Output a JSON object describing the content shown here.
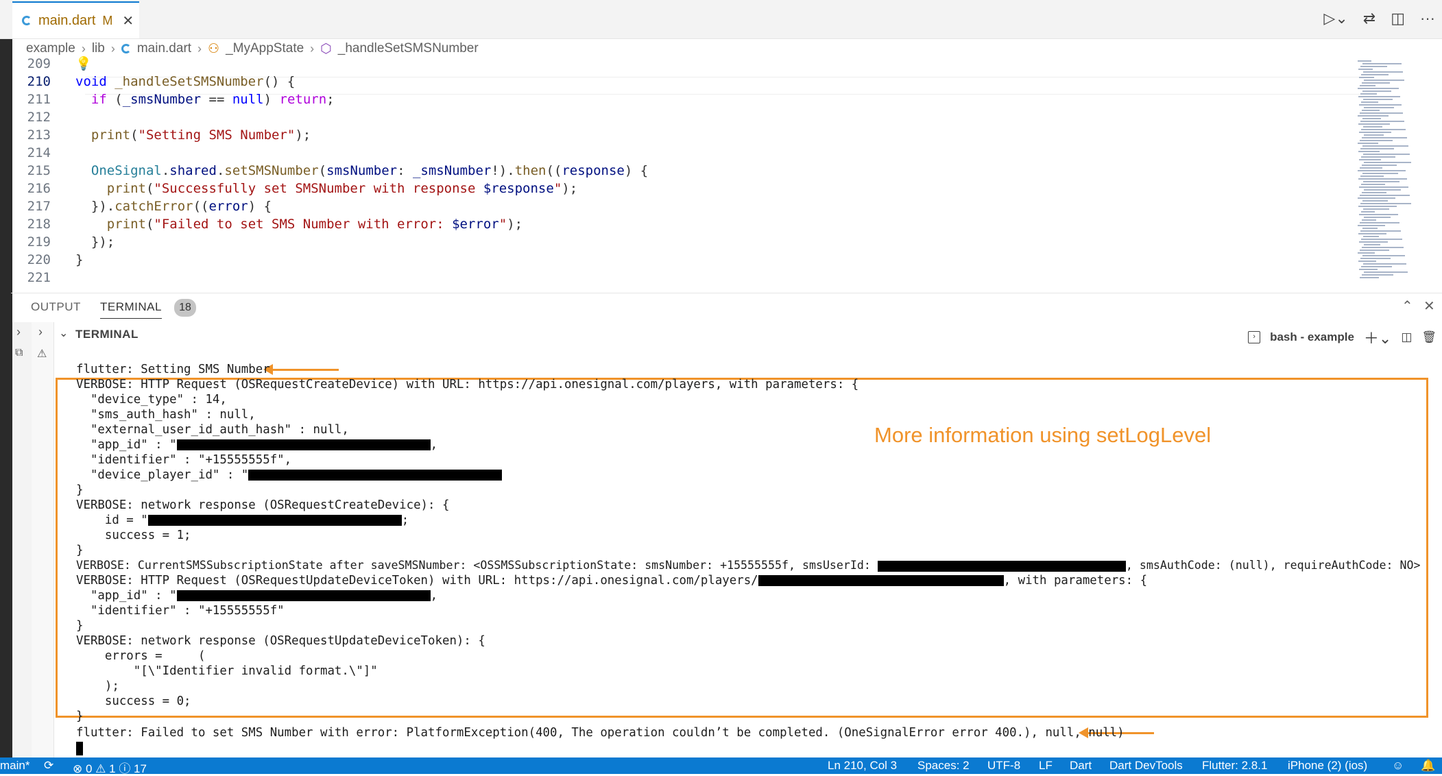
{
  "tab": {
    "name": "main.dart",
    "modified": "M"
  },
  "top_actions": {
    "run_icon": "run-debug-icon",
    "compare_icon": "compare-icon",
    "split_icon": "split-editor-icon",
    "more_icon": "more-actions-icon",
    "more_label": "···"
  },
  "breadcrumb": [
    "example",
    "lib",
    "main.dart",
    "_MyAppState",
    "_handleSetSMSNumber"
  ],
  "editor": {
    "lines": [
      {
        "n": "209",
        "code": ""
      },
      {
        "n": "210",
        "code": "void _handleSetSMSNumber() {"
      },
      {
        "n": "211",
        "code": "  if (_smsNumber == null) return;"
      },
      {
        "n": "212",
        "code": ""
      },
      {
        "n": "213",
        "code": "  print(\"Setting SMS Number\");"
      },
      {
        "n": "214",
        "code": ""
      },
      {
        "n": "215",
        "code": "  OneSignal.shared.setSMSNumber(smsNumber: _smsNumber!).then((response) {"
      },
      {
        "n": "216",
        "code": "    print(\"Successfully set SMSNumber with response $response\");"
      },
      {
        "n": "217",
        "code": "  }).catchError((error) {"
      },
      {
        "n": "218",
        "code": "    print(\"Failed to set SMS Number with error: $error\");"
      },
      {
        "n": "219",
        "code": "  });"
      },
      {
        "n": "220",
        "code": "}"
      },
      {
        "n": "221",
        "code": ""
      }
    ]
  },
  "panel": {
    "tab_output": "OUTPUT",
    "tab_terminal": "TERMINAL",
    "badge": "18",
    "section_title": "TERMINAL",
    "shell": "bash - example"
  },
  "terminal": {
    "l1": "flutter: Setting SMS Number",
    "l2": "VERBOSE: HTTP Request (OSRequestCreateDevice) with URL: https://api.onesignal.com/players, with parameters: {",
    "l3": "  \"device_type\" : 14,",
    "l4": "  \"sms_auth_hash\" : null,",
    "l5": "  \"external_user_id_auth_hash\" : null,",
    "l6a": "  \"app_id\" : \"",
    "l6b": ",",
    "l7": "  \"identifier\" : \"+15555555f\",",
    "l8": "  \"device_player_id\" : \"",
    "l9": "}",
    "l10": "VERBOSE: network response (OSRequestCreateDevice): {",
    "l11a": "    id = \"",
    "l11b": ";",
    "l12": "    success = 1;",
    "l13": "}",
    "l14a": "VERBOSE: CurrentSMSSubscriptionState after saveSMSNumber: <OSSMSSubscriptionState: smsNumber: +15555555f, smsUserId: ",
    "l14b": ", smsAuthCode: (null), requireAuthCode: NO>",
    "l15a": "VERBOSE: HTTP Request (OSRequestUpdateDeviceToken) with URL: https://api.onesignal.com/players/",
    "l15b": ", with parameters: {",
    "l16a": "  \"app_id\" : \"",
    "l16b": ",",
    "l17": "  \"identifier\" : \"+15555555f\"",
    "l18": "}",
    "l19": "VERBOSE: network response (OSRequestUpdateDeviceToken): {",
    "l20": "    errors =     (",
    "l21": "        \"[\\\"Identifier invalid format.\\\"]\"",
    "l22": "    );",
    "l23": "    success = 0;",
    "l24": "}",
    "l25": "flutter: Failed to set SMS Number with error: PlatformException(400, The operation couldn’t be completed. (OneSignalError error 400.), null, null)",
    "annotation": "More information using setLogLevel"
  },
  "statusbar": {
    "branch": "main*",
    "sync_icon": "sync-icon",
    "errors": "0",
    "warnings": "1",
    "info": "17",
    "position": "Ln 210, Col 3",
    "spaces": "Spaces: 2",
    "encoding": "UTF-8",
    "eol": "LF",
    "language": "Dart",
    "devtools": "Dart DevTools",
    "flutter": "Flutter: 2.8.1",
    "device": "iPhone (2) (ios)"
  },
  "colors": {
    "accent": "#0b7ad1",
    "annotation": "#f0932a"
  }
}
